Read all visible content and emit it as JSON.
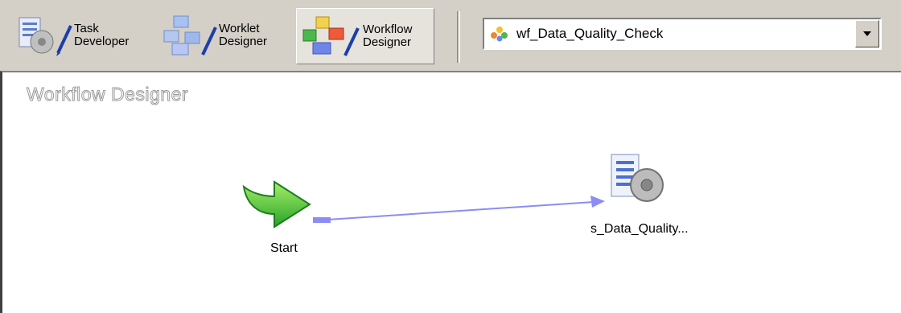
{
  "toolbar": {
    "task_developer": "Task\nDeveloper",
    "worklet_designer": "Worklet\nDesigner",
    "workflow_designer": "Workflow\nDesigner"
  },
  "workflow_selector": {
    "value": "wf_Data_Quality_Check"
  },
  "canvas": {
    "title": "Workflow Designer",
    "nodes": {
      "start_label": "Start",
      "session_label": "s_Data_Quality..."
    }
  },
  "colors": {
    "link": "#8c8cf5",
    "start_arrow": "#3bb83b",
    "background": "#d4d0c8"
  }
}
